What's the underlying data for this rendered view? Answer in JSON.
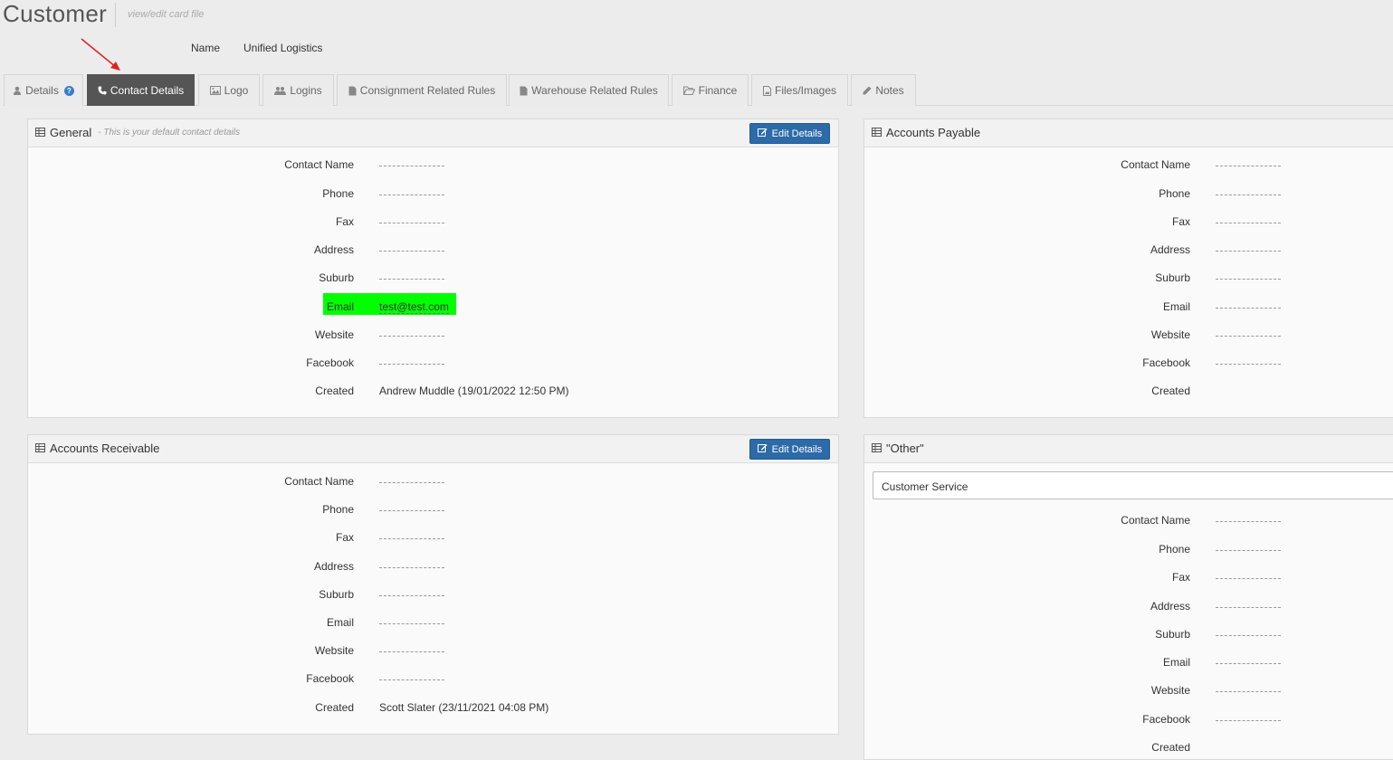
{
  "header": {
    "title": "Customer",
    "subtitle": "view/edit card file",
    "name_label": "Name",
    "name_value": "Unified Logistics"
  },
  "tabs": [
    {
      "label": "Details",
      "icon": "user-icon",
      "help": "?"
    },
    {
      "label": "Contact Details",
      "icon": "phone-icon",
      "active": true
    },
    {
      "label": "Logo",
      "icon": "image-icon"
    },
    {
      "label": "Logins",
      "icon": "users-icon"
    },
    {
      "label": "Consignment Related Rules",
      "icon": "file-icon"
    },
    {
      "label": "Warehouse Related Rules",
      "icon": "file-icon"
    },
    {
      "label": "Finance",
      "icon": "folder-open-icon"
    },
    {
      "label": "Files/Images",
      "icon": "file-image-icon"
    },
    {
      "label": "Notes",
      "icon": "pencil-icon"
    }
  ],
  "edit_label": "Edit Details",
  "panels": {
    "general": {
      "title": "General",
      "note": "- This is your default contact details",
      "fields": {
        "contact_name": "Contact Name",
        "phone": "Phone",
        "fax": "Fax",
        "address": "Address",
        "suburb": "Suburb",
        "email": "Email",
        "website": "Website",
        "facebook": "Facebook",
        "created": "Created"
      },
      "email_value": "test@test.com",
      "created_value": "Andrew Muddle (19/01/2022 12:50 PM)"
    },
    "accounts_receivable": {
      "title": "Accounts Receivable",
      "fields": {
        "contact_name": "Contact Name",
        "phone": "Phone",
        "fax": "Fax",
        "address": "Address",
        "suburb": "Suburb",
        "email": "Email",
        "website": "Website",
        "facebook": "Facebook",
        "created": "Created"
      },
      "created_value": "Scott Slater (23/11/2021 04:08 PM)"
    },
    "accounts_payable": {
      "title": "Accounts Payable",
      "fields": {
        "contact_name": "Contact Name",
        "phone": "Phone",
        "fax": "Fax",
        "address": "Address",
        "suburb": "Suburb",
        "email": "Email",
        "website": "Website",
        "facebook": "Facebook",
        "created": "Created"
      }
    },
    "other": {
      "title": "\"Other\"",
      "select_value": "Customer Service",
      "fields": {
        "contact_name": "Contact Name",
        "phone": "Phone",
        "fax": "Fax",
        "address": "Address",
        "suburb": "Suburb",
        "email": "Email",
        "website": "Website",
        "facebook": "Facebook",
        "created": "Created"
      }
    }
  },
  "colors": {
    "active_tab": "#555555",
    "edit_button": "#2c6aa8",
    "email_highlight": "#00ff00",
    "arrow": "#e02020"
  }
}
